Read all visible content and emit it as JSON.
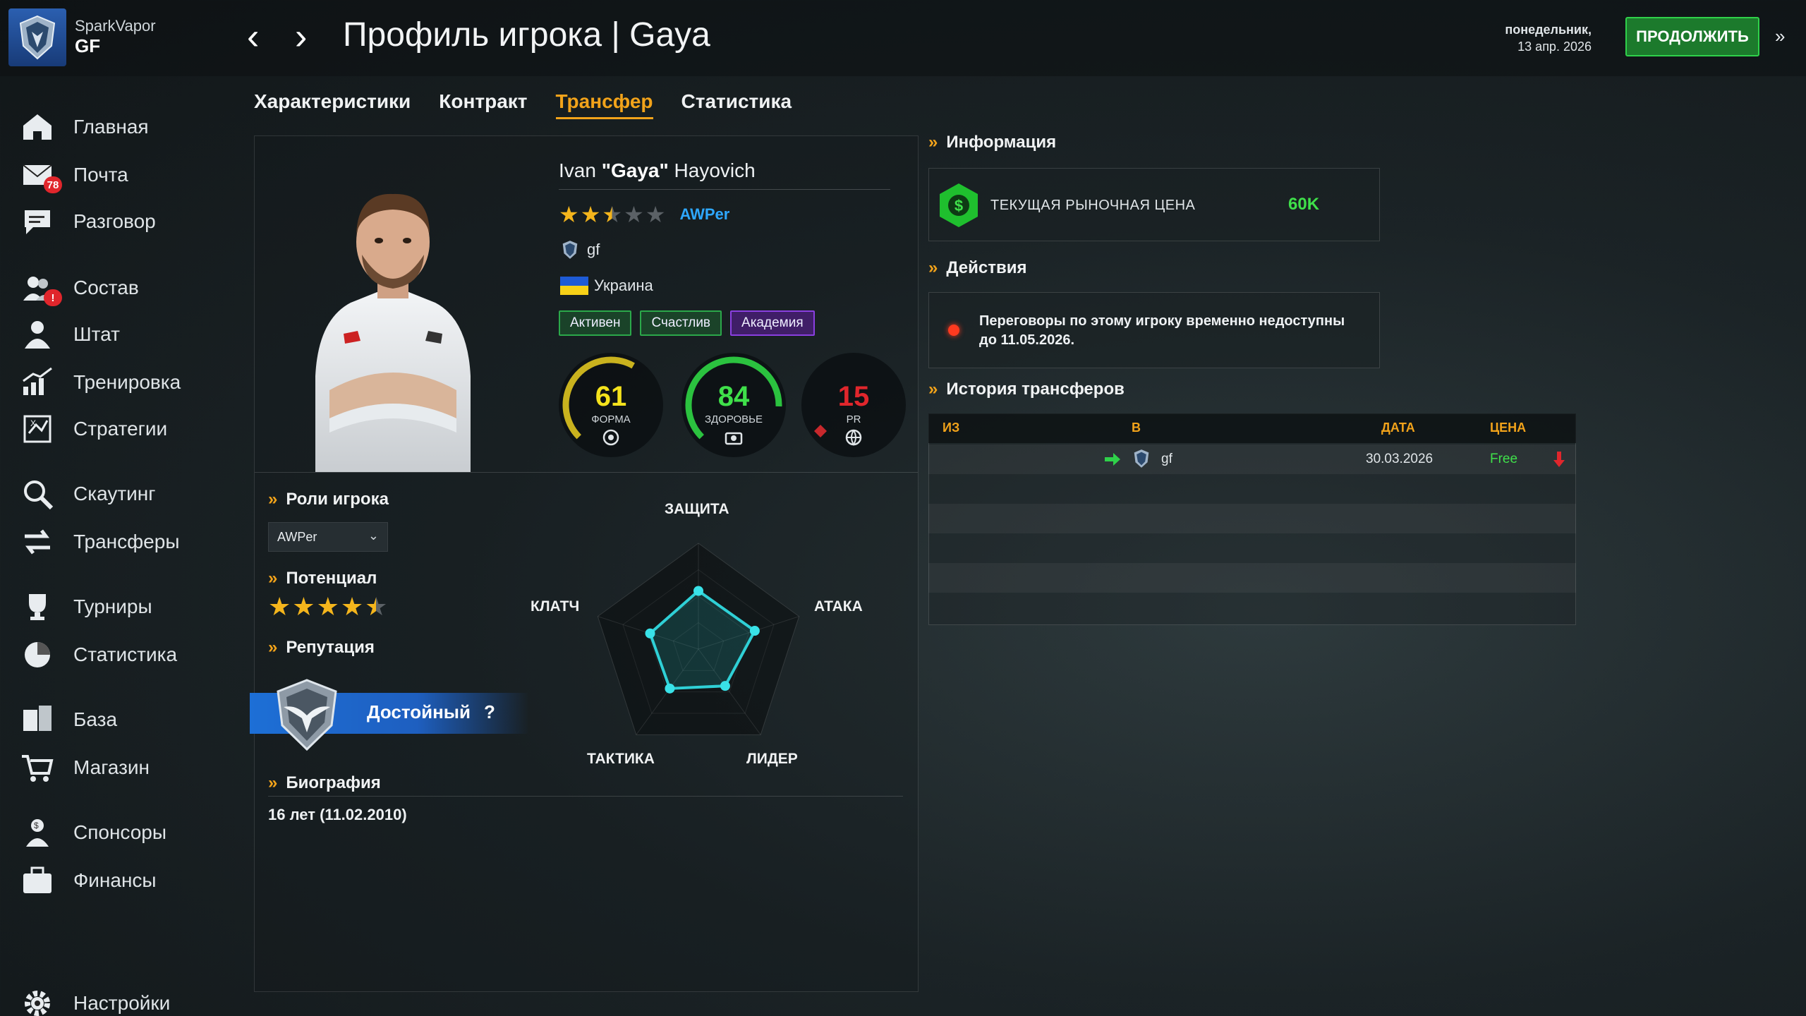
{
  "header": {
    "team_small": "SparkVapor",
    "team_big": "GF",
    "title": "Профиль игрока | Gaya",
    "date_day": "понедельник,",
    "date": "13 апр. 2026",
    "continue_label": "ПРОДОЛЖИТЬ"
  },
  "sidebar": {
    "items": [
      {
        "label": "Главная",
        "icon": "home-icon"
      },
      {
        "label": "Почта",
        "icon": "mail-icon",
        "badge": "78"
      },
      {
        "label": "Разговор",
        "icon": "chat-icon"
      },
      {
        "label": "Состав",
        "icon": "roster-icon",
        "badge": "!"
      },
      {
        "label": "Штат",
        "icon": "staff-icon"
      },
      {
        "label": "Тренировка",
        "icon": "training-icon"
      },
      {
        "label": "Стратегии",
        "icon": "strategy-icon"
      },
      {
        "label": "Скаутинг",
        "icon": "scouting-icon"
      },
      {
        "label": "Трансферы",
        "icon": "transfers-icon"
      },
      {
        "label": "Турниры",
        "icon": "trophy-icon"
      },
      {
        "label": "Статистика",
        "icon": "stats-icon"
      },
      {
        "label": "База",
        "icon": "base-icon"
      },
      {
        "label": "Магазин",
        "icon": "cart-icon"
      },
      {
        "label": "Спонсоры",
        "icon": "sponsor-icon"
      },
      {
        "label": "Финансы",
        "icon": "briefcase-icon"
      },
      {
        "label": "Настройки",
        "icon": "gear-icon"
      }
    ]
  },
  "tabs": [
    {
      "label": "Характеристики",
      "active": false
    },
    {
      "label": "Контракт",
      "active": false
    },
    {
      "label": "Трансфер",
      "active": true
    },
    {
      "label": "Статистика",
      "active": false
    }
  ],
  "player": {
    "first": "Ivan ",
    "nick": "\"Gaya\"",
    "last": " Hayovich",
    "rating_stars": 2.5,
    "role": "AWPer",
    "team": "gf",
    "country": "Украина",
    "tags": [
      "Активен",
      "Счастлив",
      "Академия"
    ],
    "form": {
      "value": "61",
      "label": "ФОРМА",
      "fraction": 0.61
    },
    "health": {
      "value": "84",
      "label": "ЗДОРОВЬЕ",
      "fraction": 0.84
    },
    "pr": {
      "value": "15",
      "label": "PR"
    }
  },
  "roles": {
    "title": "Роли игрока",
    "selected": "AWPer"
  },
  "potential": {
    "title": "Потенциал",
    "stars": 4.5
  },
  "reputation": {
    "title": "Репутация",
    "label": "Достойный",
    "help": "?"
  },
  "bio": {
    "title": "Биография",
    "text": "16 лет (11.02.2010)"
  },
  "radar": {
    "labels": [
      "ЗАЩИТА",
      "АТАКА",
      "ЛИДЕР",
      "ТАКТИКА",
      "КЛАТЧ"
    ],
    "values": [
      0.55,
      0.56,
      0.43,
      0.46,
      0.48
    ]
  },
  "info": {
    "title": "Информация",
    "price_label": "ТЕКУЩАЯ РЫНОЧНАЯ ЦЕНА",
    "price_value": "60K"
  },
  "actions": {
    "title": "Действия",
    "text": "Переговоры по этому игроку временно недоступны до 11.05.2026."
  },
  "history": {
    "title": "История трансферов",
    "columns": [
      "ИЗ",
      "В",
      "ДАТА",
      "ЦЕНА"
    ],
    "rows": [
      {
        "from": "",
        "to": "gf",
        "date": "30.03.2026",
        "price": "Free"
      }
    ]
  },
  "colors": {
    "accent": "#f2a31a",
    "green": "#2fd14a",
    "blue": "#2ea8ff",
    "red": "#e0262c"
  }
}
